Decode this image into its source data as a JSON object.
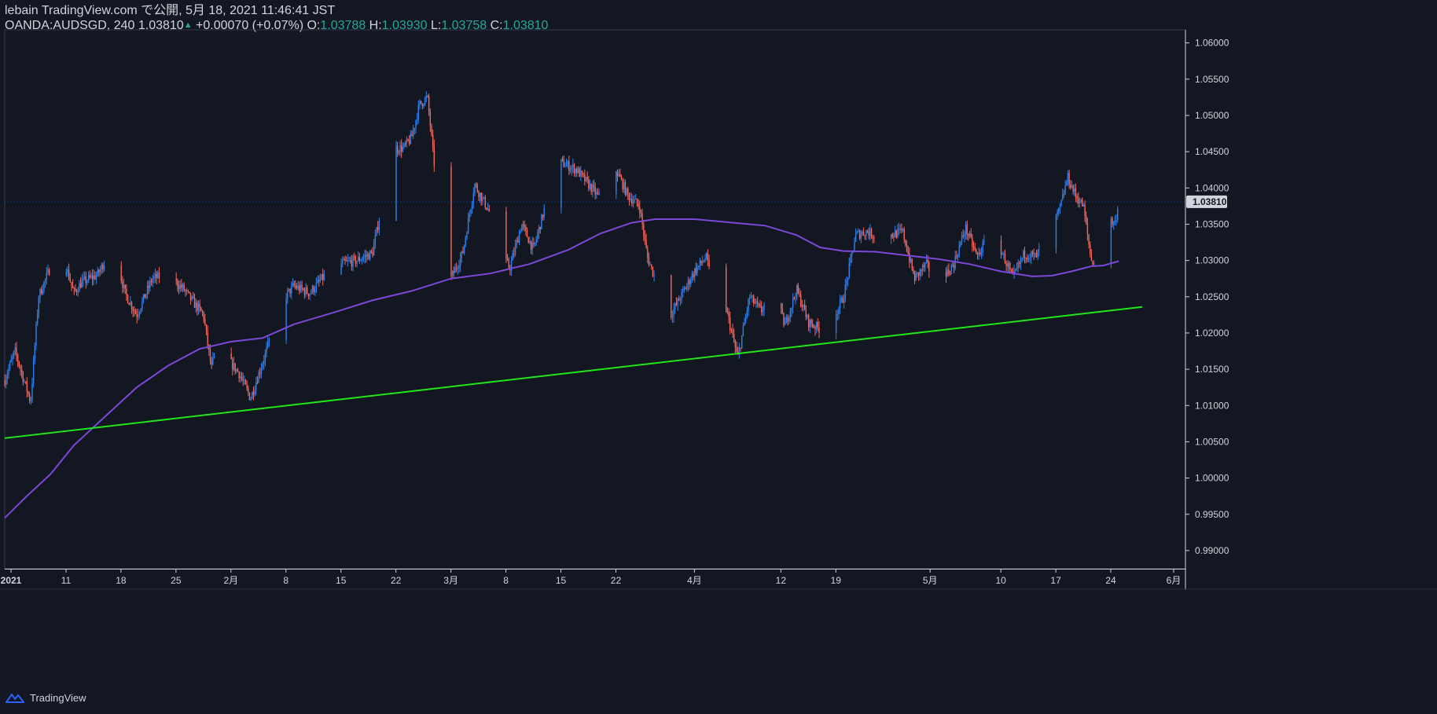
{
  "header": {
    "title": "lebain TradingView.com で公開, 5月 18, 2021 11:46:41 JST",
    "symbol": "OANDA:AUDSGD, 240",
    "last_price": "1.03810",
    "change": "+0.00070 (+0.07%)",
    "open_label": "O:",
    "open": "1.03788",
    "high_label": "H:",
    "high": "1.03930",
    "low_label": "L:",
    "low": "1.03758",
    "close_label": "C:",
    "close": "1.03810"
  },
  "footer": {
    "brand": "TradingView"
  },
  "colors": {
    "background": "#131722",
    "up": "#2f80ed",
    "down": "#f4665c",
    "ma": "#7b48d8",
    "trendline": "#22e61c",
    "axis_text": "#d1d4dc",
    "price_tag_bg": "#d1d4dc"
  },
  "chart_data": {
    "type": "candlestick",
    "price_axis_ticks": [
      "1.06000",
      "1.05500",
      "1.05000",
      "1.04500",
      "1.04000",
      "1.03500",
      "1.03000",
      "1.02500",
      "1.02000",
      "1.01500",
      "1.01000",
      "1.00500",
      "1.00000",
      "0.99500",
      "0.99000"
    ],
    "ylim": [
      0.9875,
      1.0618
    ],
    "last_price_tag": "1.03810",
    "time_axis_ticks": [
      "2021",
      "11",
      "18",
      "25",
      "2月",
      "8",
      "15",
      "22",
      "3月",
      "8",
      "15",
      "22",
      "4月",
      "12",
      "19",
      "5月",
      "10",
      "17",
      "24",
      "6月"
    ],
    "time_axis_days": [
      4,
      11,
      18,
      25,
      32,
      39,
      46,
      53,
      60,
      67,
      74,
      81,
      91,
      102,
      109,
      121,
      130,
      137,
      144,
      152
    ],
    "xlim": [
      3.2,
      153.5
    ],
    "bars_per_day": 6,
    "close_path": [
      {
        "day": 3.2,
        "price": 1.0135
      },
      {
        "day": 4.5,
        "price": 1.0175
      },
      {
        "day": 6.5,
        "price": 1.0105
      },
      {
        "day": 7.5,
        "price": 1.025
      },
      {
        "day": 9,
        "price": 1.029
      },
      {
        "day": 10.5,
        "price": 1.031
      },
      {
        "day": 12,
        "price": 1.0255
      },
      {
        "day": 13,
        "price": 1.027
      },
      {
        "day": 15,
        "price": 1.028
      },
      {
        "day": 17,
        "price": 1.032
      },
      {
        "day": 18.5,
        "price": 1.0255
      },
      {
        "day": 20,
        "price": 1.0225
      },
      {
        "day": 22,
        "price": 1.0275
      },
      {
        "day": 24,
        "price": 1.028
      },
      {
        "day": 26,
        "price": 1.026
      },
      {
        "day": 27,
        "price": 1.0245
      },
      {
        "day": 28.5,
        "price": 1.0225
      },
      {
        "day": 29.5,
        "price": 1.015
      },
      {
        "day": 30.5,
        "price": 1.02
      },
      {
        "day": 31.5,
        "price": 1.0165
      },
      {
        "day": 33,
        "price": 1.0145
      },
      {
        "day": 34.5,
        "price": 1.011
      },
      {
        "day": 36.5,
        "price": 1.0175
      },
      {
        "day": 38.5,
        "price": 1.0245
      },
      {
        "day": 40,
        "price": 1.0265
      },
      {
        "day": 42,
        "price": 1.0255
      },
      {
        "day": 44,
        "price": 1.028
      },
      {
        "day": 46,
        "price": 1.0295
      },
      {
        "day": 48,
        "price": 1.03
      },
      {
        "day": 50,
        "price": 1.031
      },
      {
        "day": 51,
        "price": 1.0365
      },
      {
        "day": 52.5,
        "price": 1.0455
      },
      {
        "day": 54,
        "price": 1.0455
      },
      {
        "day": 55,
        "price": 1.047
      },
      {
        "day": 56,
        "price": 1.0515
      },
      {
        "day": 57,
        "price": 1.0525
      },
      {
        "day": 58,
        "price": 1.042
      },
      {
        "day": 59,
        "price": 1.032
      },
      {
        "day": 60,
        "price": 1.0275
      },
      {
        "day": 61.5,
        "price": 1.031
      },
      {
        "day": 63,
        "price": 1.0405
      },
      {
        "day": 64.5,
        "price": 1.0375
      },
      {
        "day": 65.5,
        "price": 1.0355
      },
      {
        "day": 66.5,
        "price": 1.0305
      },
      {
        "day": 67.5,
        "price": 1.029
      },
      {
        "day": 69,
        "price": 1.035
      },
      {
        "day": 70.5,
        "price": 1.0315
      },
      {
        "day": 72,
        "price": 1.0375
      },
      {
        "day": 74,
        "price": 1.0435
      },
      {
        "day": 76,
        "price": 1.0425
      },
      {
        "day": 77.5,
        "price": 1.0405
      },
      {
        "day": 79,
        "price": 1.0385
      },
      {
        "day": 79.8,
        "price": 1.0495
      },
      {
        "day": 81,
        "price": 1.0425
      },
      {
        "day": 82.5,
        "price": 1.039
      },
      {
        "day": 84,
        "price": 1.0375
      },
      {
        "day": 85,
        "price": 1.0305
      },
      {
        "day": 86.5,
        "price": 1.026
      },
      {
        "day": 88,
        "price": 1.0225
      },
      {
        "day": 89.5,
        "price": 1.0255
      },
      {
        "day": 91,
        "price": 1.0285
      },
      {
        "day": 92.5,
        "price": 1.0305
      },
      {
        "day": 93.5,
        "price": 1.0255
      },
      {
        "day": 95,
        "price": 1.0235
      },
      {
        "day": 96.5,
        "price": 1.0165
      },
      {
        "day": 98,
        "price": 1.025
      },
      {
        "day": 99.5,
        "price": 1.023
      },
      {
        "day": 101,
        "price": 1.0265
      },
      {
        "day": 102.5,
        "price": 1.021
      },
      {
        "day": 104,
        "price": 1.026
      },
      {
        "day": 105.5,
        "price": 1.0215
      },
      {
        "day": 107,
        "price": 1.0205
      },
      {
        "day": 108.5,
        "price": 1.0215
      },
      {
        "day": 110,
        "price": 1.025
      },
      {
        "day": 111.5,
        "price": 1.0335
      },
      {
        "day": 113,
        "price": 1.034
      },
      {
        "day": 114.5,
        "price": 1.033
      },
      {
        "day": 116,
        "price": 1.0335
      },
      {
        "day": 117.5,
        "price": 1.034
      },
      {
        "day": 119,
        "price": 1.0275
      },
      {
        "day": 120.5,
        "price": 1.0295
      },
      {
        "day": 122,
        "price": 1.0265
      },
      {
        "day": 124,
        "price": 1.0295
      },
      {
        "day": 125.5,
        "price": 1.0345
      },
      {
        "day": 127,
        "price": 1.0305
      },
      {
        "day": 128.5,
        "price": 1.0335
      },
      {
        "day": 130,
        "price": 1.0315
      },
      {
        "day": 131.5,
        "price": 1.0275
      },
      {
        "day": 133,
        "price": 1.031
      },
      {
        "day": 134.5,
        "price": 1.0305
      },
      {
        "day": 136,
        "price": 1.0335
      },
      {
        "day": 137.5,
        "price": 1.037
      },
      {
        "day": 138.5,
        "price": 1.0415
      },
      {
        "day": 139.5,
        "price": 1.039
      },
      {
        "day": 140.5,
        "price": 1.0375
      },
      {
        "day": 141.5,
        "price": 1.03
      },
      {
        "day": 142.5,
        "price": 1.0295
      },
      {
        "day": 143.5,
        "price": 1.036
      },
      {
        "day": 144.5,
        "price": 1.035
      },
      {
        "day": 145,
        "price": 1.0381
      }
    ],
    "moving_average": [
      {
        "day": 3.2,
        "price": 0.9945
      },
      {
        "day": 6,
        "price": 0.9975
      },
      {
        "day": 9,
        "price": 1.0005
      },
      {
        "day": 12,
        "price": 1.0045
      },
      {
        "day": 16,
        "price": 1.0085
      },
      {
        "day": 20,
        "price": 1.0125
      },
      {
        "day": 24,
        "price": 1.0155
      },
      {
        "day": 28,
        "price": 1.0178
      },
      {
        "day": 32,
        "price": 1.0188
      },
      {
        "day": 36,
        "price": 1.0193
      },
      {
        "day": 40,
        "price": 1.0212
      },
      {
        "day": 45,
        "price": 1.0228
      },
      {
        "day": 50,
        "price": 1.0245
      },
      {
        "day": 55,
        "price": 1.0258
      },
      {
        "day": 60,
        "price": 1.0275
      },
      {
        "day": 65,
        "price": 1.0282
      },
      {
        "day": 70,
        "price": 1.0295
      },
      {
        "day": 75,
        "price": 1.0315
      },
      {
        "day": 79,
        "price": 1.0337
      },
      {
        "day": 83,
        "price": 1.0352
      },
      {
        "day": 86,
        "price": 1.0357
      },
      {
        "day": 91,
        "price": 1.0357
      },
      {
        "day": 96,
        "price": 1.0352
      },
      {
        "day": 100,
        "price": 1.0348
      },
      {
        "day": 104,
        "price": 1.0335
      },
      {
        "day": 107,
        "price": 1.0318
      },
      {
        "day": 110,
        "price": 1.0313
      },
      {
        "day": 114,
        "price": 1.0312
      },
      {
        "day": 118,
        "price": 1.0307
      },
      {
        "day": 122,
        "price": 1.0302
      },
      {
        "day": 126,
        "price": 1.0295
      },
      {
        "day": 130,
        "price": 1.0285
      },
      {
        "day": 134,
        "price": 1.0278
      },
      {
        "day": 136.5,
        "price": 1.0279
      },
      {
        "day": 139,
        "price": 1.0285
      },
      {
        "day": 141.5,
        "price": 1.0292
      },
      {
        "day": 143,
        "price": 1.0293
      },
      {
        "day": 145,
        "price": 1.0299
      }
    ],
    "trendline": [
      {
        "day": 3.2,
        "price": 1.0055
      },
      {
        "day": 148.0,
        "price": 1.0236
      }
    ]
  }
}
